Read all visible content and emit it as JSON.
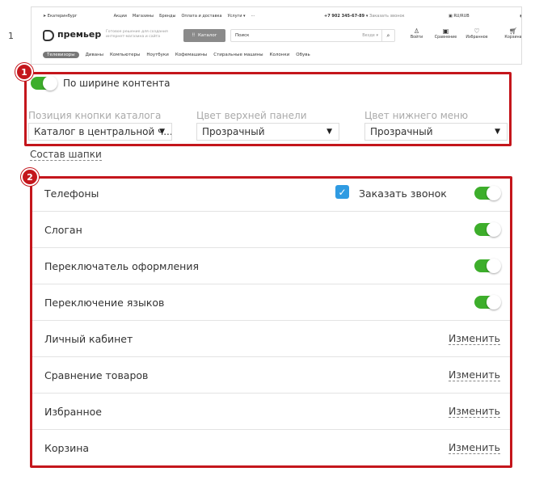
{
  "row_number": "1",
  "preview": {
    "location": "Екатеринбург",
    "top_links": [
      "Акции",
      "Магазины",
      "Бренды",
      "Оплата и доставка",
      "Услуги ▾",
      "···"
    ],
    "phone": "+7 902 345-67-89 ▾",
    "callback": "Заказать звонок",
    "lang": "RU/RUB",
    "brand": "премьер",
    "slogan": "Готовое решение для создания интернет-магазина и сайта",
    "catalog_button": "Каталог",
    "search_placeholder": "Поиск",
    "search_scope": "Везде ▾",
    "icons": [
      {
        "icon": "user-icon",
        "label": "Войти"
      },
      {
        "icon": "compare-icon",
        "label": "Сравнение"
      },
      {
        "icon": "heart-icon",
        "label": "Избранное"
      },
      {
        "icon": "cart-icon",
        "label": "Корзина"
      }
    ],
    "nav": [
      "Телевизоры",
      "Диваны",
      "Компьютеры",
      "Ноутбуки",
      "Кофемашины",
      "Стиральные машины",
      "Колонки",
      "Обувь"
    ]
  },
  "block1": {
    "badge": "1",
    "full_width_label": "По ширине контента",
    "full_width_on": true,
    "fields": [
      {
        "label": "Позиция кнопки каталога",
        "value": "Каталог в центральной ч..."
      },
      {
        "label": "Цвет верхней панели",
        "value": "Прозрачный"
      },
      {
        "label": "Цвет нижнего меню",
        "value": "Прозрачный"
      }
    ]
  },
  "header_composition_link": "Состав шапки",
  "block2": {
    "badge": "2",
    "rows": [
      {
        "name": "Телефоны",
        "checkbox_label": "Заказать звонок",
        "checkbox_checked": true,
        "toggle": true
      },
      {
        "name": "Слоган",
        "toggle": true
      },
      {
        "name": "Переключатель оформления",
        "toggle": true
      },
      {
        "name": "Переключение языков",
        "toggle": true
      },
      {
        "name": "Личный кабинет",
        "action": "Изменить"
      },
      {
        "name": "Сравнение товаров",
        "action": "Изменить"
      },
      {
        "name": "Избранное",
        "action": "Изменить"
      },
      {
        "name": "Корзина",
        "action": "Изменить"
      }
    ]
  },
  "colors": {
    "accent_red": "#c4161c",
    "toggle_green": "#3dae2b",
    "checkbox_blue": "#2f9be2"
  }
}
